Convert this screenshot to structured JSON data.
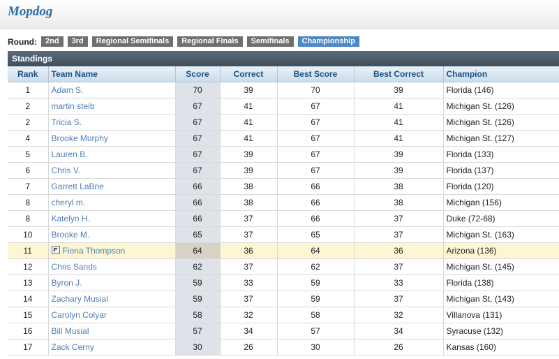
{
  "site": {
    "title": "Mopdog"
  },
  "rounds": {
    "label": "Round:",
    "tabs": [
      {
        "label": "2nd",
        "active": false
      },
      {
        "label": "3rd",
        "active": false
      },
      {
        "label": "Regional Semifinals",
        "active": false
      },
      {
        "label": "Regional Finals",
        "active": false
      },
      {
        "label": "Semifinals",
        "active": false
      },
      {
        "label": "Championship",
        "active": true
      }
    ]
  },
  "standings": {
    "title": "Standings",
    "columns": [
      "Rank",
      "Team Name",
      "Score",
      "Correct",
      "Best Score",
      "Best Correct",
      "Champion"
    ],
    "rows": [
      {
        "rank": "1",
        "team": "Adam S.",
        "score": "70",
        "correct": "39",
        "best_score": "70",
        "best_correct": "39",
        "champion": "Florida (146)"
      },
      {
        "rank": "2",
        "team": "martin steib",
        "score": "67",
        "correct": "41",
        "best_score": "67",
        "best_correct": "41",
        "champion": "Michigan St. (126)"
      },
      {
        "rank": "2",
        "team": "Tricia S.",
        "score": "67",
        "correct": "41",
        "best_score": "67",
        "best_correct": "41",
        "champion": "Michigan St. (126)"
      },
      {
        "rank": "4",
        "team": "Brooke Murphy",
        "score": "67",
        "correct": "41",
        "best_score": "67",
        "best_correct": "41",
        "champion": "Michigan St. (127)"
      },
      {
        "rank": "5",
        "team": "Lauren B.",
        "score": "67",
        "correct": "39",
        "best_score": "67",
        "best_correct": "39",
        "champion": "Florida (133)"
      },
      {
        "rank": "6",
        "team": "Chris V.",
        "score": "67",
        "correct": "39",
        "best_score": "67",
        "best_correct": "39",
        "champion": "Florida (137)"
      },
      {
        "rank": "7",
        "team": "Garrett LaBrie",
        "score": "66",
        "correct": "38",
        "best_score": "66",
        "best_correct": "38",
        "champion": "Florida (120)"
      },
      {
        "rank": "8",
        "team": "cheryl m.",
        "score": "66",
        "correct": "38",
        "best_score": "66",
        "best_correct": "38",
        "champion": "Michigan (156)"
      },
      {
        "rank": "8",
        "team": "Katelyn H.",
        "score": "66",
        "correct": "37",
        "best_score": "66",
        "best_correct": "37",
        "champion": "Duke (72-68)"
      },
      {
        "rank": "10",
        "team": "Brooke M.",
        "score": "65",
        "correct": "37",
        "best_score": "65",
        "best_correct": "37",
        "champion": "Michigan St. (163)"
      },
      {
        "rank": "11",
        "team": "Fiona Thompson",
        "score": "64",
        "correct": "36",
        "best_score": "64",
        "best_correct": "36",
        "champion": "Arizona (136)",
        "highlight": true,
        "icon": "team-badge-icon"
      },
      {
        "rank": "12",
        "team": "Chris Sands",
        "score": "62",
        "correct": "37",
        "best_score": "62",
        "best_correct": "37",
        "champion": "Michigan St. (145)"
      },
      {
        "rank": "13",
        "team": "Byron J.",
        "score": "59",
        "correct": "33",
        "best_score": "59",
        "best_correct": "33",
        "champion": "Florida (138)"
      },
      {
        "rank": "14",
        "team": "Zachary Musial",
        "score": "59",
        "correct": "37",
        "best_score": "59",
        "best_correct": "37",
        "champion": "Michigan St. (143)"
      },
      {
        "rank": "15",
        "team": "Carolyn Colyar",
        "score": "58",
        "correct": "32",
        "best_score": "58",
        "best_correct": "32",
        "champion": "Villanova (131)"
      },
      {
        "rank": "16",
        "team": "Bill Musial",
        "score": "57",
        "correct": "34",
        "best_score": "57",
        "best_correct": "34",
        "champion": "Syracuse (132)"
      },
      {
        "rank": "17",
        "team": "Zack Cerny",
        "score": "30",
        "correct": "26",
        "best_score": "30",
        "best_correct": "26",
        "champion": "Kansas (160)"
      }
    ]
  },
  "colors": {
    "link": "#4e7fb8",
    "active_tab": "#4e87c3",
    "inactive_tab": "#6f6f6f",
    "highlight_row": "#fdf6d3"
  }
}
